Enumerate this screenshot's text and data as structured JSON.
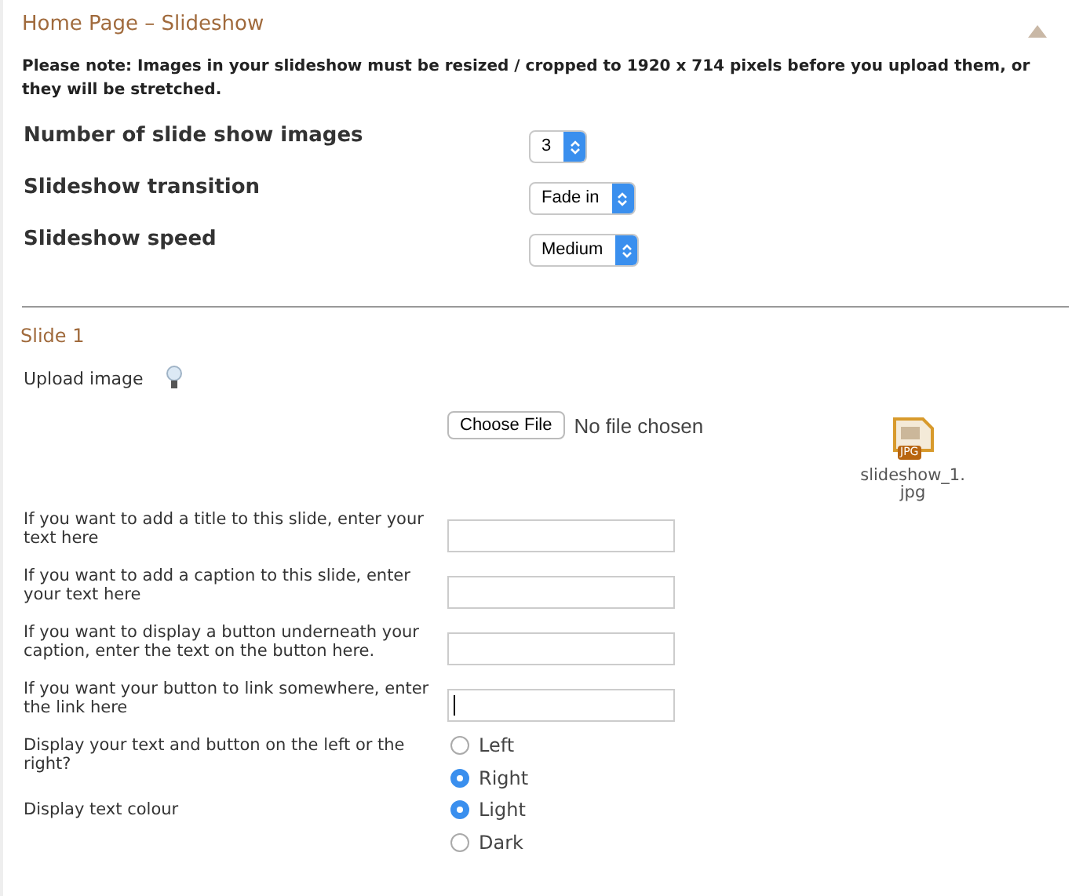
{
  "panel": {
    "title": "Home Page – Slideshow",
    "collapsed": false
  },
  "note": "Please note: Images in your slideshow must be resized / cropped to 1920 x 714 pixels before you upload them, or they will be stretched.",
  "settings": [
    {
      "label": "Number of slide show images",
      "value": "3"
    },
    {
      "label": "Slideshow transition",
      "value": "Fade in"
    },
    {
      "label": "Slideshow speed",
      "value": "Medium"
    }
  ],
  "slide": {
    "title": "Slide 1",
    "upload": {
      "label": "Upload image",
      "button": "Choose File",
      "status": "No file chosen",
      "file_name": "slideshow_1.",
      "file_ext": "jpg",
      "file_badge": "JPG"
    },
    "fields": [
      {
        "label": "If you want to add a title to this slide, enter your text here",
        "focused": false
      },
      {
        "label": "If you want to add a caption to this slide, enter your text here",
        "focused": false
      },
      {
        "label": "If you want to display a button underneath your caption, enter the text on the button here.",
        "focused": false
      },
      {
        "label": "If you want your button to link somewhere, enter the link here",
        "focused": true
      }
    ],
    "choices": [
      {
        "label": "Display your text and button on the left or the right?",
        "options": [
          {
            "label": "Left",
            "selected": false
          },
          {
            "label": "Right",
            "selected": true
          }
        ]
      },
      {
        "label": "Display text colour",
        "options": [
          {
            "label": "Light",
            "selected": true
          },
          {
            "label": "Dark",
            "selected": false
          }
        ]
      }
    ]
  }
}
